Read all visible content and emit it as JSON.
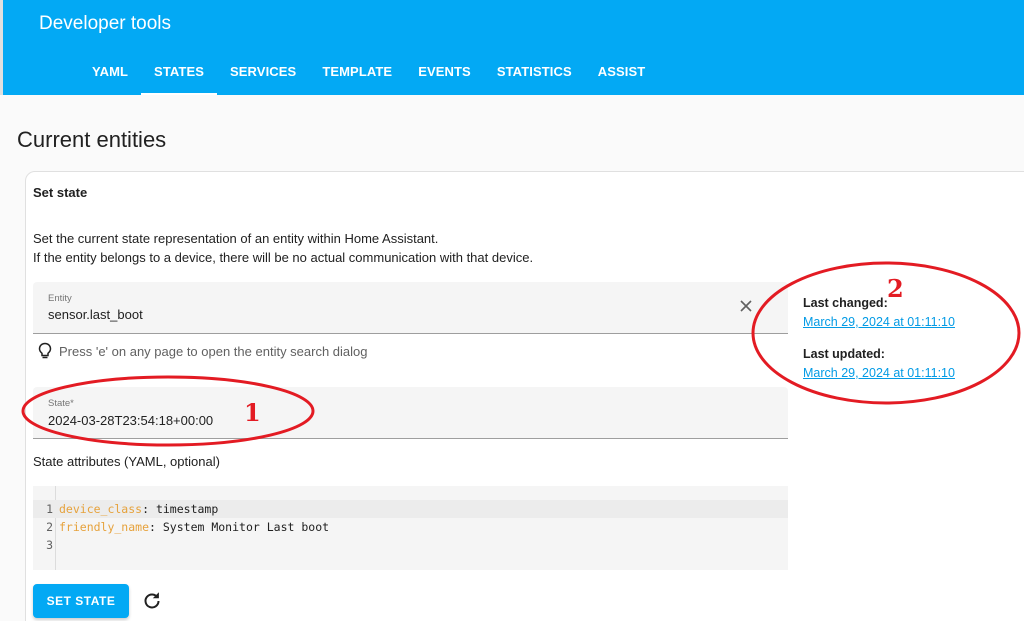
{
  "header": {
    "title": "Developer tools",
    "tabs": [
      {
        "label": "YAML"
      },
      {
        "label": "STATES"
      },
      {
        "label": "SERVICES"
      },
      {
        "label": "TEMPLATE"
      },
      {
        "label": "EVENTS"
      },
      {
        "label": "STATISTICS"
      },
      {
        "label": "ASSIST"
      }
    ],
    "active_tab": "STATES"
  },
  "page": {
    "title": "Current entities"
  },
  "set_state": {
    "title": "Set state",
    "description_line1": "Set the current state representation of an entity within Home Assistant.",
    "description_line2": "If the entity belongs to a device, there will be no actual communication with that device.",
    "entity_field": {
      "label": "Entity",
      "value": "sensor.last_boot"
    },
    "hint": "Press 'e' on any page to open the entity search dialog",
    "state_field": {
      "label": "State*",
      "value": "2024-03-28T23:54:18+00:00"
    },
    "attributes_label": "State attributes (YAML, optional)",
    "editor": {
      "line_numbers": [
        "1",
        "2",
        "3"
      ],
      "lines": [
        {
          "key": "device_class",
          "sep": ": ",
          "value": "timestamp"
        },
        {
          "key": "friendly_name",
          "sep": ": ",
          "value": "System Monitor Last boot"
        }
      ]
    },
    "button_label": "SET STATE"
  },
  "meta": {
    "last_changed_label": "Last changed:",
    "last_changed_value": "March 29, 2024 at 01:11:10",
    "last_updated_label": "Last updated:",
    "last_updated_value": "March 29, 2024 at 01:11:10"
  },
  "annotations": {
    "mark1": "1",
    "mark2": "2"
  },
  "colors": {
    "primary": "#03a9f4",
    "annotation": "#e31b23",
    "yaml_key": "#e6a23c"
  },
  "icons": [
    "close-icon",
    "lightbulb-icon",
    "refresh-icon"
  ]
}
